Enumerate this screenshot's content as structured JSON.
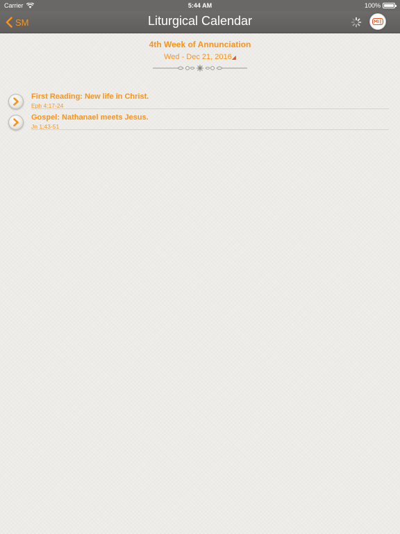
{
  "status_bar": {
    "carrier": "Carrier",
    "time": "5:44 AM",
    "battery_text": "100%",
    "battery_level": 1.0
  },
  "nav": {
    "back_label": "SM",
    "title": "Liturgical Calendar",
    "back_icon": "chevron-left-icon",
    "loading_icon": "spinner-icon",
    "logo_icon": "app-logo-icon"
  },
  "header": {
    "week_title": "4th Week of Annunciation",
    "date": "Wed - Dec 21, 2016",
    "date_caret": "◢"
  },
  "readings": [
    {
      "title": "First Reading: New life in Christ.",
      "reference": "Eph 4:17-24"
    },
    {
      "title": "Gospel: Nathanael meets Jesus.",
      "reference": "Jn 1:43-51"
    }
  ],
  "colors": {
    "accent": "#f7941d",
    "nav_background": "#666462",
    "page_background": "#efeeea"
  }
}
